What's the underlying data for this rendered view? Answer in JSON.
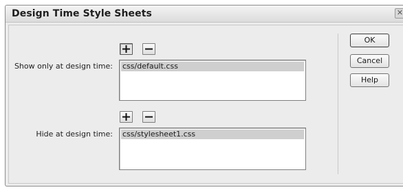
{
  "dialog": {
    "title": "Design Time Style Sheets",
    "close_icon": "close-icon"
  },
  "show_section": {
    "label": "Show only at design time:",
    "add_icon": "plus-icon",
    "remove_icon": "minus-icon",
    "items": [
      "css/default.css"
    ]
  },
  "hide_section": {
    "label": "Hide at design time:",
    "add_icon": "plus-icon",
    "remove_icon": "minus-icon",
    "items": [
      "css/stylesheet1.css"
    ]
  },
  "buttons": {
    "ok": "OK",
    "cancel": "Cancel",
    "help": "Help"
  }
}
